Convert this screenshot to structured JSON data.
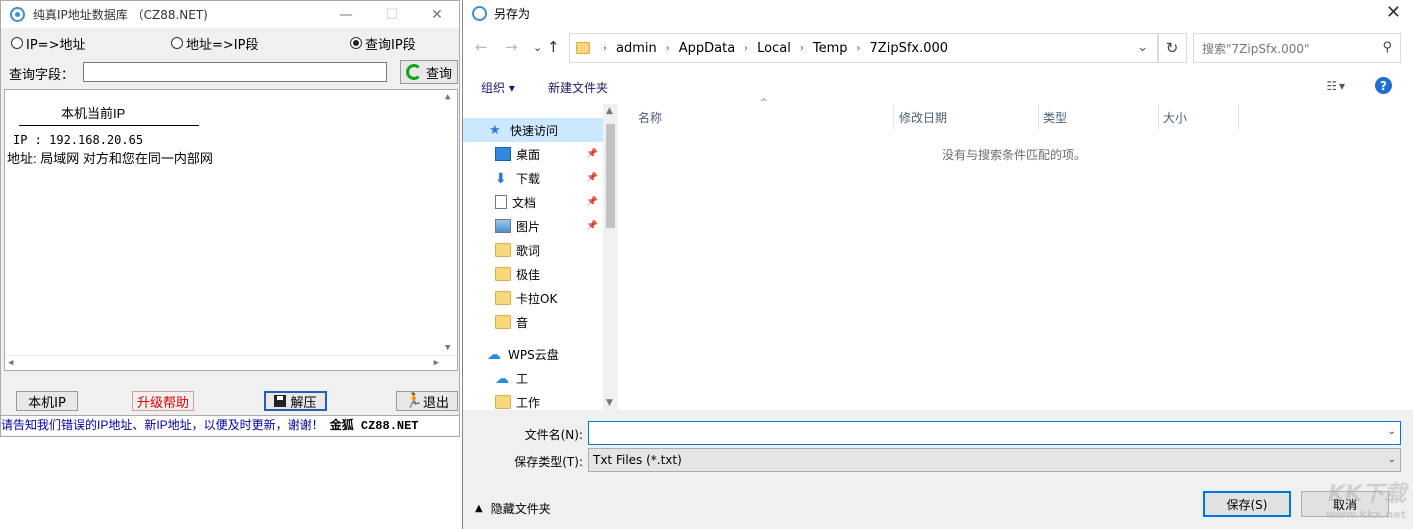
{
  "app": {
    "title": "纯真IP地址数据库 （CZ88.NET)",
    "controls": {
      "minimize": "—",
      "maximize": "☐",
      "close": "✕"
    },
    "radios": [
      {
        "label": "IP=>地址",
        "checked": false
      },
      {
        "label": "地址=>IP段",
        "checked": false
      },
      {
        "label": "查询IP段",
        "checked": true
      }
    ],
    "query_label": "查询字段：",
    "query_value": "",
    "query_button": "查询",
    "result": {
      "header": "本机当前IP",
      "ip_line": "IP :  192.168.20.65",
      "addr_line": "地址:  局域网 对方和您在同一内部网"
    },
    "buttons": {
      "local_ip": "本机IP",
      "upgrade": "升级帮助",
      "extract": "解压",
      "exit": "退出"
    },
    "ticker_text": "请告知我们错误的IP地址、新IP地址，以便及时更新，谢谢！",
    "ticker_brand": "金狐 CZ88.NET"
  },
  "dialog": {
    "title": "另存为",
    "close": "✕",
    "breadcrumb": [
      "admin",
      "AppData",
      "Local",
      "Temp",
      "7ZipSfx.000"
    ],
    "search_placeholder": "搜索\"7ZipSfx.000\"",
    "toolbar": {
      "organize": "组织 ▾",
      "new_folder": "新建文件夹",
      "help": "?"
    },
    "nav_items": [
      {
        "label": "快速访问",
        "icon": "star-icon",
        "pinned": false
      },
      {
        "label": "桌面",
        "icon": "desktop-icon",
        "pinned": true
      },
      {
        "label": "下载",
        "icon": "download-icon",
        "pinned": true
      },
      {
        "label": "文档",
        "icon": "document-icon",
        "pinned": true
      },
      {
        "label": "图片",
        "icon": "picture-icon",
        "pinned": true
      },
      {
        "label": "歌词",
        "icon": "folder-icon",
        "pinned": false
      },
      {
        "label": "极佳",
        "icon": "folder-icon",
        "pinned": false
      },
      {
        "label": "卡拉OK",
        "icon": "folder-icon",
        "pinned": false
      },
      {
        "label": "音",
        "icon": "folder-icon",
        "pinned": false
      },
      {
        "label": "WPS云盘",
        "icon": "cloud-icon",
        "pinned": false
      },
      {
        "label": "工",
        "icon": "cloud-icon",
        "pinned": false
      },
      {
        "label": "工作",
        "icon": "folder-icon",
        "pinned": false
      }
    ],
    "columns": [
      "名称",
      "修改日期",
      "类型",
      "大小"
    ],
    "empty_message": "没有与搜索条件匹配的项。",
    "filename_label": "文件名(N):",
    "filename_value": "",
    "filetype_label": "保存类型(T):",
    "filetype_value": "Txt Files (*.txt)",
    "hide_folders": "隐藏文件夹",
    "save_button": "保存(S)",
    "cancel_button": "取消"
  },
  "watermark": {
    "text": "KK下载",
    "url": "www.kkx.net"
  }
}
